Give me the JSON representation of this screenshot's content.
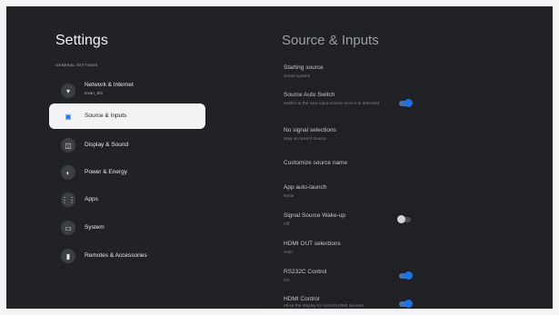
{
  "left": {
    "title": "Settings",
    "section": "GENERAL SETTINGS",
    "items": [
      {
        "label": "Network & Internet",
        "sub": "Evan_5G"
      },
      {
        "label": "Source & Inputs"
      },
      {
        "label": "Display & Sound"
      },
      {
        "label": "Power & Energy"
      },
      {
        "label": "Apps"
      },
      {
        "label": "System"
      },
      {
        "label": "Remotes & Accessories"
      }
    ]
  },
  "right": {
    "title": "Source & Inputs",
    "settings": [
      {
        "name": "Starting source",
        "sub": "Smart system"
      },
      {
        "name": "Source Auto Switch",
        "sub": "Switch to the new input source once it is detected.",
        "toggle": "on"
      },
      {
        "name": "No signal selections",
        "sub": "Stay at current source"
      },
      {
        "name": "Customize source name"
      },
      {
        "name": "App auto-launch",
        "sub": "None"
      },
      {
        "name": "Signal Source Wake-up",
        "sub": "Off",
        "toggle": "off"
      },
      {
        "name": "HDMI OUT selections",
        "sub": "Auto"
      },
      {
        "name": "RS232C Control",
        "sub": "On",
        "toggle": "on"
      },
      {
        "name": "HDMI Control",
        "sub": "Allow the display to control HDMI devices",
        "toggle": "on"
      }
    ]
  }
}
